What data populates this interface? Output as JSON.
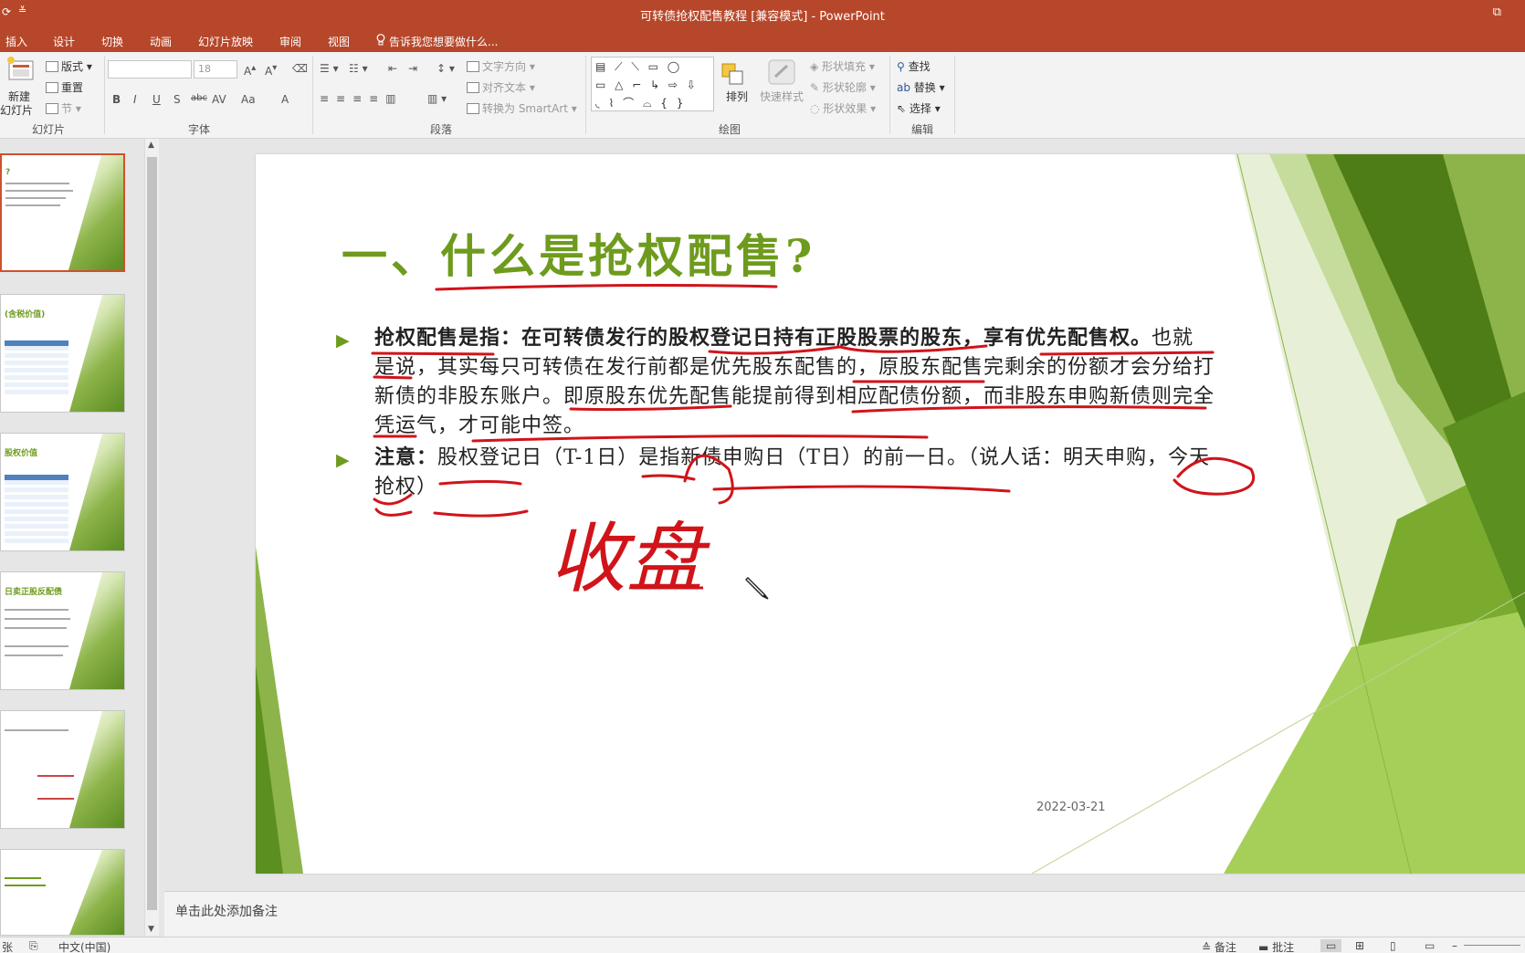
{
  "window": {
    "title": "可转债抢权配售教程 [兼容模式] - PowerPoint",
    "quick_access": "⟳",
    "quick_access2": "≚",
    "restore_icon": "⧉"
  },
  "menu": {
    "tabs": [
      "插入",
      "设计",
      "切换",
      "动画",
      "幻灯片放映",
      "审阅",
      "视图"
    ],
    "tell_me": "告诉我您想要做什么..."
  },
  "ribbon": {
    "slides_group": {
      "label": "幻灯片",
      "new_slide_line1": "新建",
      "new_slide_line2": "幻灯片",
      "layout": "版式",
      "reset": "重置",
      "section": "节"
    },
    "font_group": {
      "label": "字体",
      "font_size": "18",
      "bold": "B",
      "italic": "I",
      "underline": "U",
      "shadow": "S",
      "strike": "abc",
      "spacing": "AV",
      "case": "Aa",
      "color": "A"
    },
    "paragraph_group": {
      "label": "段落",
      "text_direction": "文字方向",
      "align_text": "对齐文本",
      "smartart": "转换为 SmartArt"
    },
    "drawing_group": {
      "label": "绘图",
      "arrange": "排列",
      "quick_styles": "快速样式",
      "shape_fill": "形状填充",
      "shape_outline": "形状轮廓",
      "shape_effects": "形状效果"
    },
    "editing_group": {
      "label": "编辑",
      "find": "查找",
      "replace": "替换",
      "select": "选择"
    }
  },
  "thumbnails": [
    {
      "title": "?",
      "selected": true
    },
    {
      "title": "(含税价值)",
      "selected": false
    },
    {
      "title": "股权价值",
      "selected": false
    },
    {
      "title": "日卖正股反配债",
      "selected": false
    },
    {
      "title": "",
      "selected": false
    },
    {
      "title": "",
      "selected": false
    }
  ],
  "slide": {
    "title": "一、什么是抢权配售?",
    "bullet1_lead": "抢权配售是指：在可转债发行的股权登记日持有正股股票的股东，享有优先配售权。",
    "bullet1_rest": "也就是说，其实每只可转债在发行前都是优先股东配售的，原股东配售完剩余的份额才会分给打新债的非股东账户。即原股东优先配售能提前得到相应配债份额，而非股东申购新债则完全凭运气，才可能中签。",
    "bullet2_lead": "注意：",
    "bullet2_rest": "股权登记日（T-1日）是指新债申购日（T日）的前一日。（说人话：明天申购，今天抢权）",
    "handwriting": "收盘",
    "date": "2022-03-21"
  },
  "notes": {
    "placeholder": "单击此处添加备注"
  },
  "status": {
    "slide_label": "张",
    "language": "中文(中国)",
    "notes_button": "备注",
    "comments_button": "批注"
  },
  "colors": {
    "accent": "#b7472a",
    "title_green": "#6e9b1d",
    "ink": "#d0141a"
  }
}
